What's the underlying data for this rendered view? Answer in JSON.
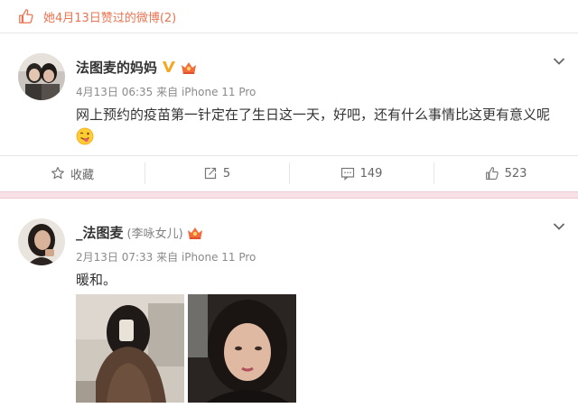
{
  "liked_header": {
    "text": "她4月13日赞过的微博(2)",
    "icon": "thumbs-up-icon",
    "color": "#eb7350"
  },
  "posts": [
    {
      "username": "法图麦的妈妈",
      "remark": "",
      "badges": [
        "verified-v-icon",
        "crown-member-icon"
      ],
      "date": "4月13日 06:35",
      "source": "来自 iPhone 11 Pro",
      "text": "网上预约的疫苗第一针定在了生日这一天，好吧，还有什么事情比这更有意义呢",
      "emoji": "tongue-wink-emoji-icon",
      "actions": {
        "favorite": "收藏",
        "repost": "5",
        "comment": "149",
        "like": "523"
      }
    },
    {
      "username": "_法图麦",
      "remark": "(李咏女儿)",
      "badges": [
        "crown-member-icon"
      ],
      "date": "2月13日 07:33",
      "source": "来自 iPhone 11 Pro",
      "text": "暖和。",
      "images": [
        "mirror-selfie-photo",
        "closeup-selfie-photo"
      ]
    }
  ],
  "colors": {
    "accent": "#eb7350",
    "verified": "#f5a623",
    "separator": "#f7e1e6"
  }
}
